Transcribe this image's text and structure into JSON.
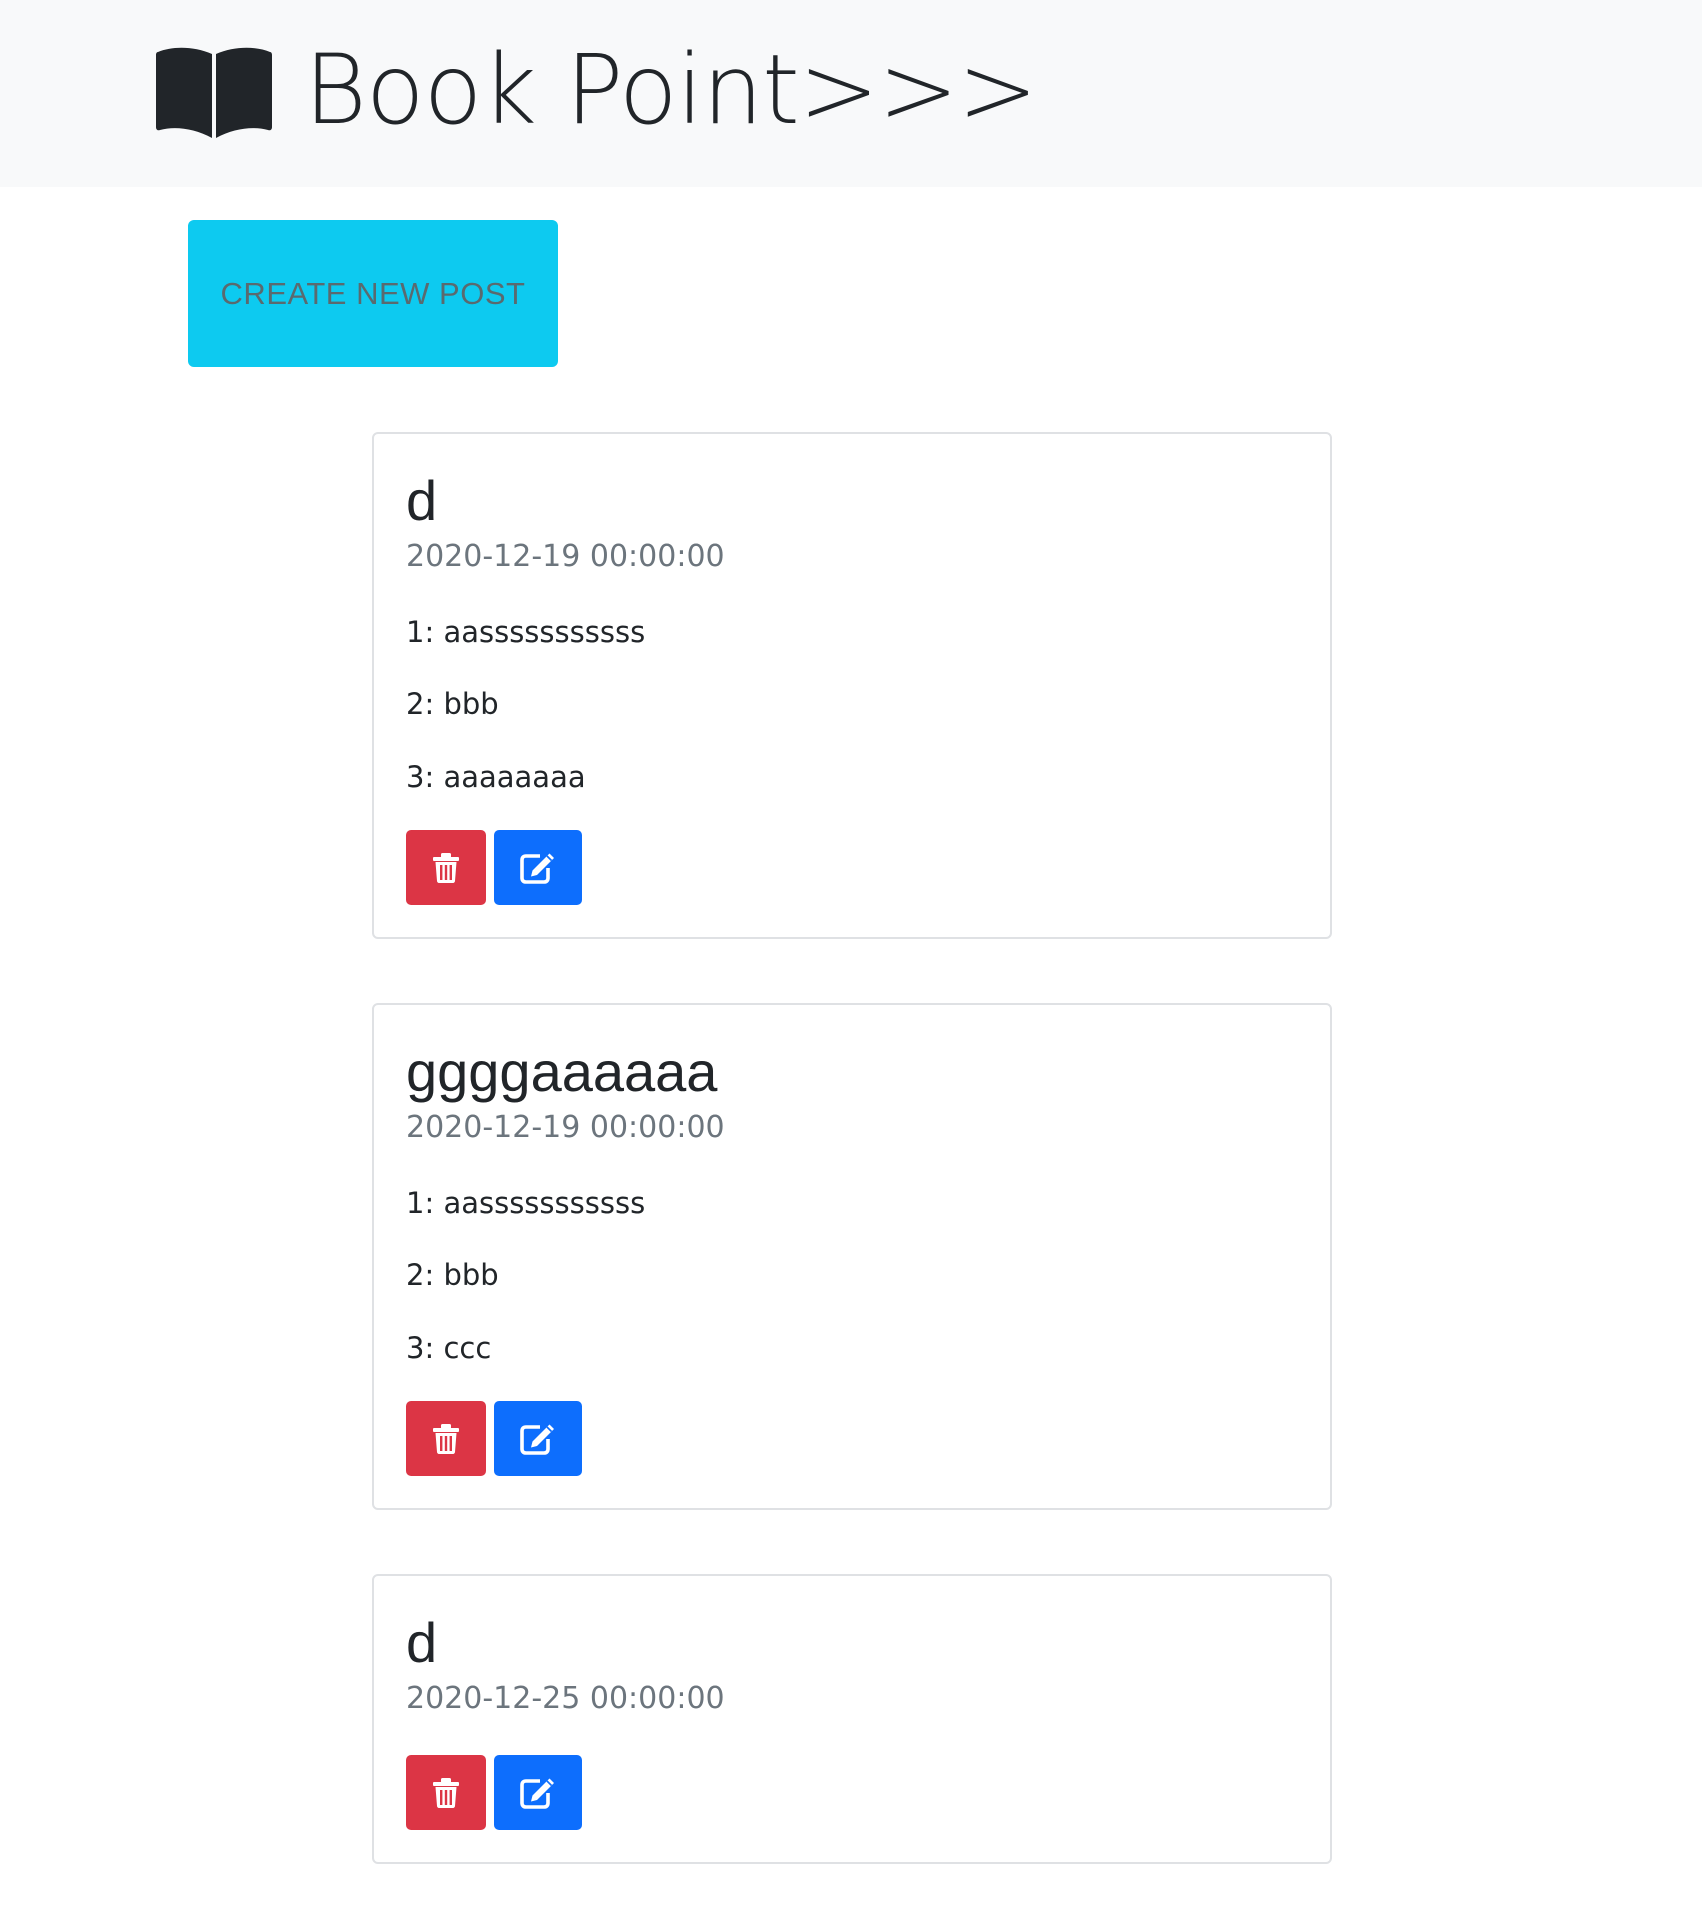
{
  "navbar": {
    "brand_icon": "book-open-icon",
    "brand_text": "Book Point>>>"
  },
  "create_button": {
    "label": "CREATE NEW POST",
    "color": "#0dcaf0"
  },
  "posts": [
    {
      "title": "d",
      "date": "2020-12-19 00:00:00",
      "lines": [
        "1: aasssssssssss",
        "2: bbb",
        "3: aaaaaaaa"
      ],
      "delete_icon": "trash-icon",
      "edit_icon": "edit-icon"
    },
    {
      "title": "ggggaaaaaa",
      "date": "2020-12-19 00:00:00",
      "lines": [
        "1: aasssssssssss",
        "2: bbb",
        "3: ccc"
      ],
      "delete_icon": "trash-icon",
      "edit_icon": "edit-icon"
    },
    {
      "title": "d",
      "date": "2020-12-25 00:00:00",
      "lines": [],
      "delete_icon": "trash-icon",
      "edit_icon": "edit-icon"
    }
  ],
  "colors": {
    "navbar_bg": "#f8f9fa",
    "delete": "#dc3545",
    "edit": "#0d6efd",
    "muted": "#6c757d"
  }
}
